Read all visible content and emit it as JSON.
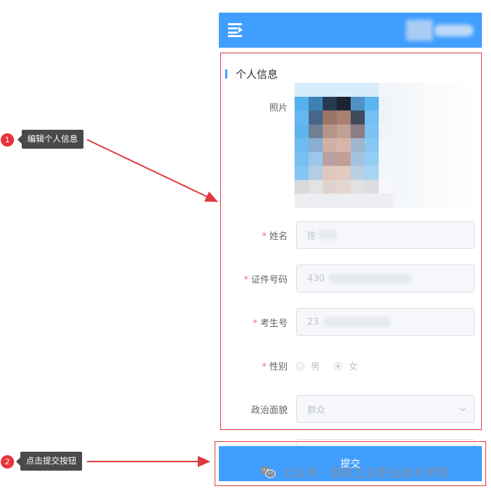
{
  "annotations": [
    {
      "number": "1",
      "label": "编辑个人信息"
    },
    {
      "number": "2",
      "label": "点击提交按钮"
    }
  ],
  "header": {
    "menu_icon": "menu-fold-icon",
    "accent_color": "#409eff"
  },
  "form": {
    "section_title": "个人信息",
    "photo_label": "照片",
    "required_mark": "*",
    "name": {
      "label": "姓名",
      "value": "陈"
    },
    "id_number": {
      "label": "证件号码",
      "value": "430"
    },
    "exam_number": {
      "label": "考生号",
      "value": "23"
    },
    "gender": {
      "label": "性别",
      "options": [
        {
          "label": "男",
          "checked": false
        },
        {
          "label": "女",
          "checked": true
        }
      ]
    },
    "political_status": {
      "label": "政治面貌",
      "value": "群众"
    }
  },
  "submit_label": "提交",
  "watermark": {
    "text": "公众号 · 邵阳工业职业技术学院",
    "icon": "wechat-icon"
  },
  "colors": {
    "required": "#f56c6c",
    "annotation_red": "#e8333a",
    "highlight_border": "#e1383e"
  }
}
